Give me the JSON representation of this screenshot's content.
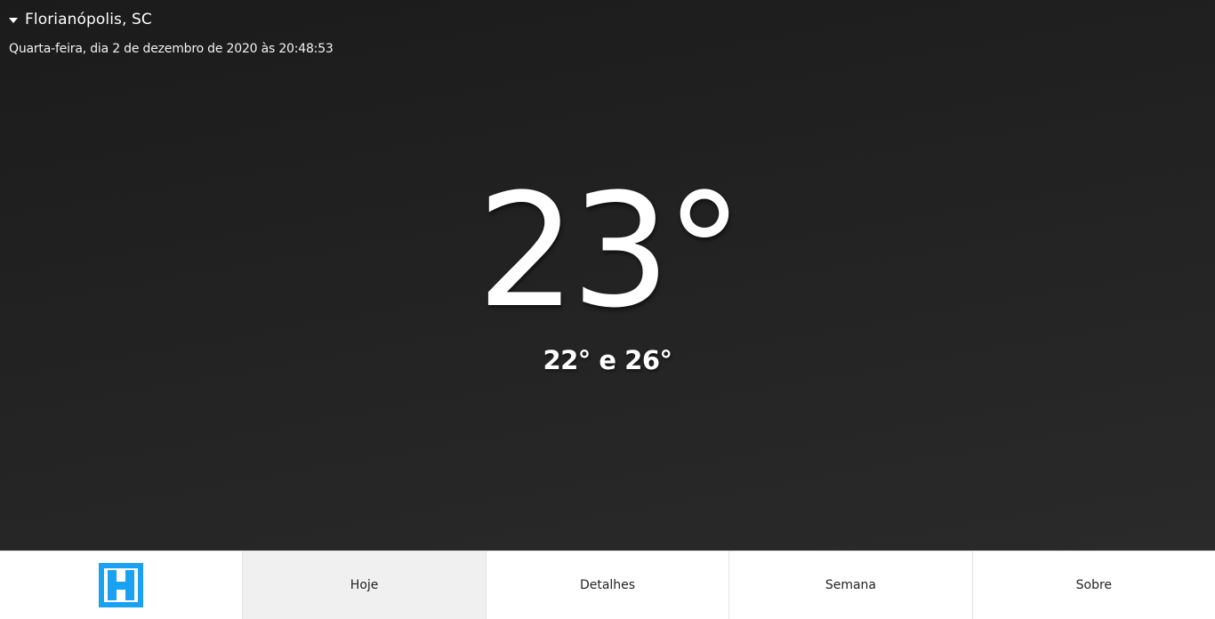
{
  "header": {
    "location": "Florianópolis, SC",
    "location_icon": "caret-down-icon",
    "datetime": "Quarta-feira, dia 2 de dezembro de 2020 às 20:48:53"
  },
  "weather": {
    "current_temp": "23°",
    "range": "22° e 26°"
  },
  "nav": {
    "logo_icon": "h-logo-icon",
    "items": [
      {
        "label": "Hoje",
        "active": true
      },
      {
        "label": "Detalhes",
        "active": false
      },
      {
        "label": "Semana",
        "active": false
      },
      {
        "label": "Sobre",
        "active": false
      }
    ]
  },
  "colors": {
    "background": "#222222",
    "nav_background": "#ffffff",
    "nav_active": "#f0f0f0",
    "logo_blue": "#1ba1f2",
    "text": "#ffffff"
  }
}
